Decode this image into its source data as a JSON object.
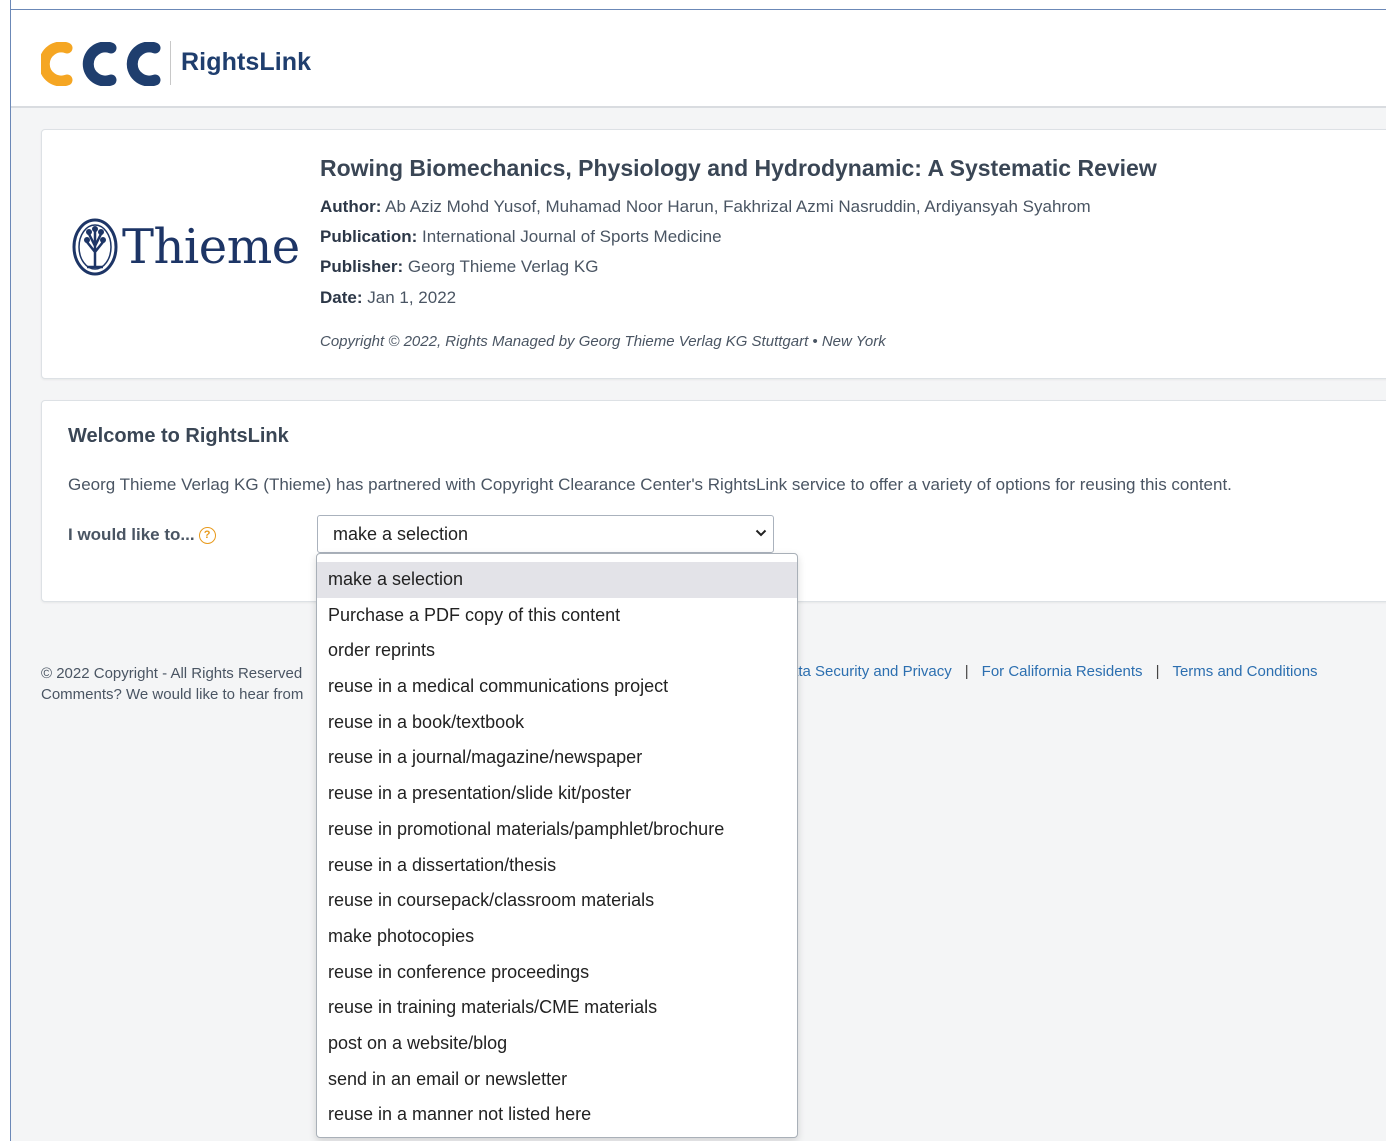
{
  "header": {
    "logo_text": "CCC",
    "product_name": "RightsLink"
  },
  "article": {
    "publisher_logo_text": "Thieme",
    "title": "Rowing Biomechanics, Physiology and Hydrodynamic: A Systematic Review",
    "author_label": "Author:",
    "author_value": "Ab Aziz Mohd Yusof, Muhamad Noor Harun, Fakhrizal Azmi Nasruddin, Ardiyansyah Syahrom",
    "publication_label": "Publication:",
    "publication_value": "International Journal of Sports Medicine",
    "publisher_label": "Publisher:",
    "publisher_value": "Georg Thieme Verlag KG",
    "date_label": "Date:",
    "date_value": "Jan 1, 2022",
    "copyright": "Copyright © 2022, Rights Managed by Georg Thieme Verlag KG Stuttgart • New York"
  },
  "welcome": {
    "title": "Welcome to RightsLink",
    "text": "Georg Thieme Verlag KG (Thieme) has partnered with Copyright Clearance Center's RightsLink service to offer a variety of options for reusing this content.",
    "like_label": "I would like to...",
    "help_glyph": "?",
    "select_value": "make a selection"
  },
  "dropdown": {
    "options": [
      "make a selection",
      "Purchase a PDF copy of this content",
      "order reprints",
      "reuse in a medical communications project",
      "reuse in a book/textbook",
      "reuse in a journal/magazine/newspaper",
      "reuse in a presentation/slide kit/poster",
      "reuse in promotional materials/pamphlet/brochure",
      "reuse in a dissertation/thesis",
      "reuse in coursepack/classroom materials",
      "make photocopies",
      "reuse in conference proceedings",
      "reuse in training materials/CME materials",
      "post on a website/blog",
      "send in an email or newsletter",
      "reuse in a manner not listed here"
    ],
    "selected_index": 0
  },
  "footer": {
    "copyright": "© 2022 Copyright - All Rights Reserved",
    "comments": "Comments? We would like to hear from",
    "links": [
      "ata Security and Privacy",
      "For California Residents",
      "Terms and Conditions"
    ],
    "separator": "|"
  },
  "colors": {
    "ccc_orange": "#f5a623",
    "ccc_blue": "#1f3e6e",
    "link_blue": "#2c6fb0"
  }
}
